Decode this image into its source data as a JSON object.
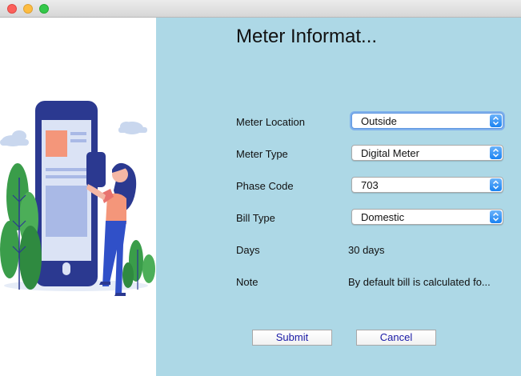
{
  "window": {
    "title": "",
    "controls": [
      "close",
      "minimize",
      "maximize"
    ]
  },
  "illustration": {
    "icon": "person-with-phone-illustration",
    "colors": {
      "phone": "#2b3990",
      "person_hair": "#2b3990",
      "shirt": "#f4967a",
      "plants": "#3a9d4a",
      "clouds": "#c9d7ee"
    }
  },
  "form": {
    "heading": "Meter Informat...",
    "meter_location": {
      "label": "Meter Location",
      "value": "Outside"
    },
    "meter_type": {
      "label": "Meter Type",
      "value": "Digital Meter"
    },
    "phase_code": {
      "label": "Phase Code",
      "value": "703"
    },
    "bill_type": {
      "label": "Bill Type",
      "value": "Domestic"
    },
    "days": {
      "label": "Days",
      "value": "30 days"
    },
    "note": {
      "label": "Note",
      "value": "By default bill is calculated fo..."
    }
  },
  "buttons": {
    "submit": "Submit",
    "cancel": "Cancel"
  },
  "colors": {
    "panel_bg": "#add8e6",
    "button_text": "#1a1aa6",
    "dropdown_accent": "#1a82f2"
  }
}
